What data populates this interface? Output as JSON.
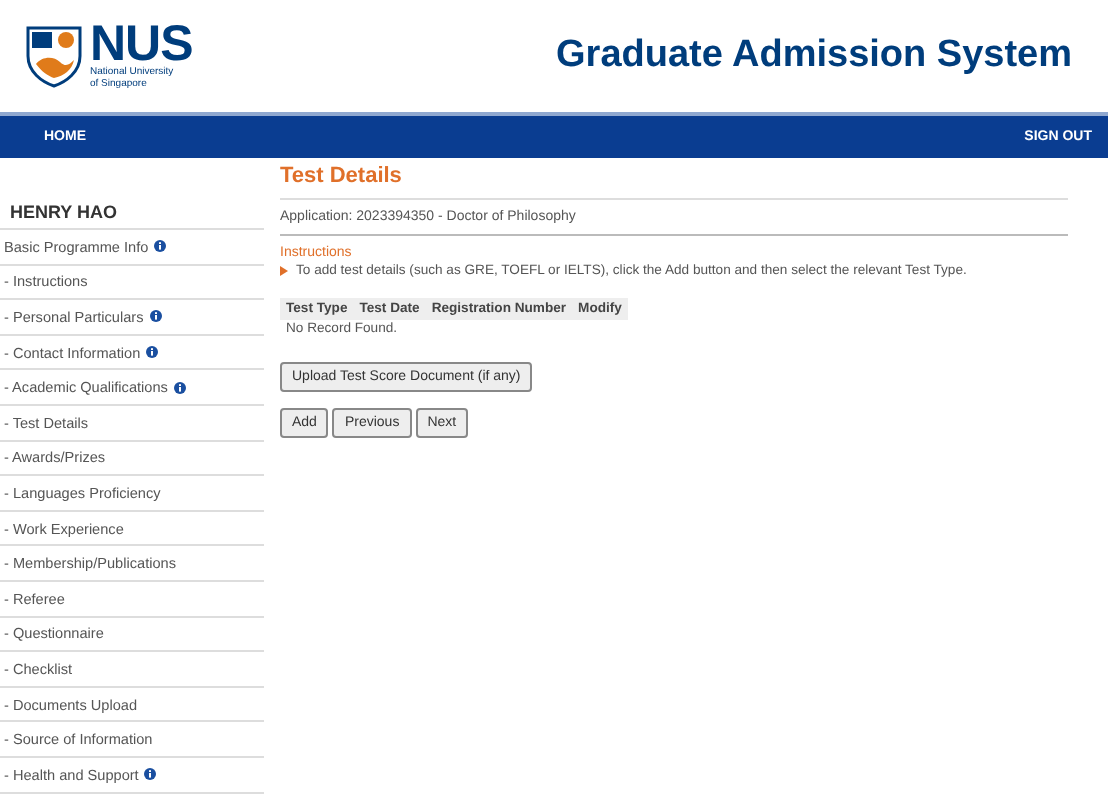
{
  "logo": {
    "wordmark": "NUS",
    "subtitle_lines": [
      "National University",
      "of Singapore"
    ]
  },
  "title": "Graduate Admission System",
  "nav": {
    "left": "HOME",
    "right": "SIGN OUT"
  },
  "sidebar": {
    "user": "HENRY HAO",
    "items": [
      {
        "label": "Basic Programme Info",
        "info": true
      },
      {
        "label": "- Instructions",
        "info": false
      },
      {
        "label": "- Personal Particulars",
        "info": true
      },
      {
        "label": "- Contact Information",
        "info": true
      },
      {
        "label": "- Academic Qualifications",
        "info": true
      },
      {
        "label": "- Test Details",
        "info": false
      },
      {
        "label": "- Awards/Prizes",
        "info": false
      },
      {
        "label": "- Languages Proficiency",
        "info": false
      },
      {
        "label": "- Work Experience",
        "info": false
      },
      {
        "label": "- Membership/Publications",
        "info": false
      },
      {
        "label": "- Referee",
        "info": false
      },
      {
        "label": "- Questionnaire",
        "info": false
      },
      {
        "label": "- Checklist",
        "info": false
      },
      {
        "label": "- Documents Upload",
        "info": false
      },
      {
        "label": "- Source of Information",
        "info": false
      },
      {
        "label": "- Health and Support",
        "info": true
      }
    ]
  },
  "main": {
    "heading": "Test Details",
    "application": "Application: 2023394350 - Doctor of Philosophy",
    "instructions_title": "Instructions",
    "instructions": [
      "To add test details (such as GRE, TOEFL or IELTS), click the Add button and then select the relevant Test Type."
    ],
    "table": {
      "columns": [
        "Test Type",
        "Test Date",
        "Registration Number",
        "Modify"
      ],
      "empty": "No Record Found."
    },
    "upload_button": "Upload Test Score Document (if any)",
    "buttons": [
      "Add",
      "Previous",
      "Next"
    ]
  }
}
